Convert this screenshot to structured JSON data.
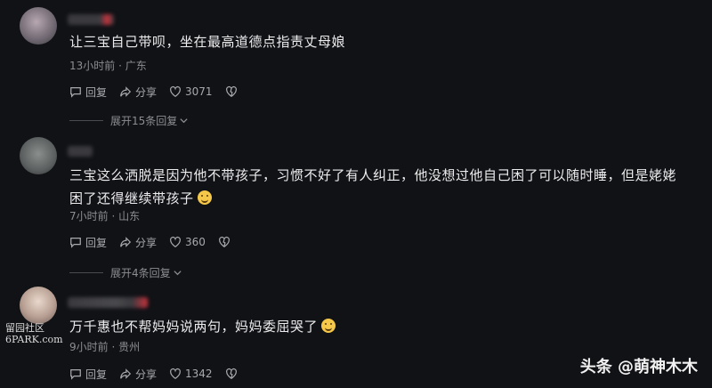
{
  "comments": [
    {
      "text": "让三宝自己带呗，坐在最高道德点指责丈母娘",
      "time": "13小时前",
      "location": "广东",
      "reply": "回复",
      "share": "分享",
      "likes": "3071",
      "expand": "展开15条回复"
    },
    {
      "text": "三宝这么洒脱是因为他不带孩子，习惯不好了有人纠正，他没想过他自己困了可以随时睡，但是姥姥困了还得继续带孩子",
      "time": "7小时前",
      "location": "山东",
      "reply": "回复",
      "share": "分享",
      "likes": "360",
      "expand": "展开4条回复"
    },
    {
      "text": "万千惠也不帮妈妈说两句，妈妈委屈哭了",
      "time": "9小时前",
      "location": "贵州",
      "reply": "回复",
      "share": "分享",
      "likes": "1342"
    }
  ],
  "watermark_left": [
    "留园社区",
    "6PARK.com"
  ],
  "watermark_right": "头条 @萌神木木",
  "colors": {
    "background": "#111216",
    "text": "#ececed",
    "meta": "#8c8d91"
  },
  "icons": [
    "reply-icon",
    "share-icon",
    "heart-icon",
    "dislike-icon",
    "chevron-down-icon"
  ]
}
